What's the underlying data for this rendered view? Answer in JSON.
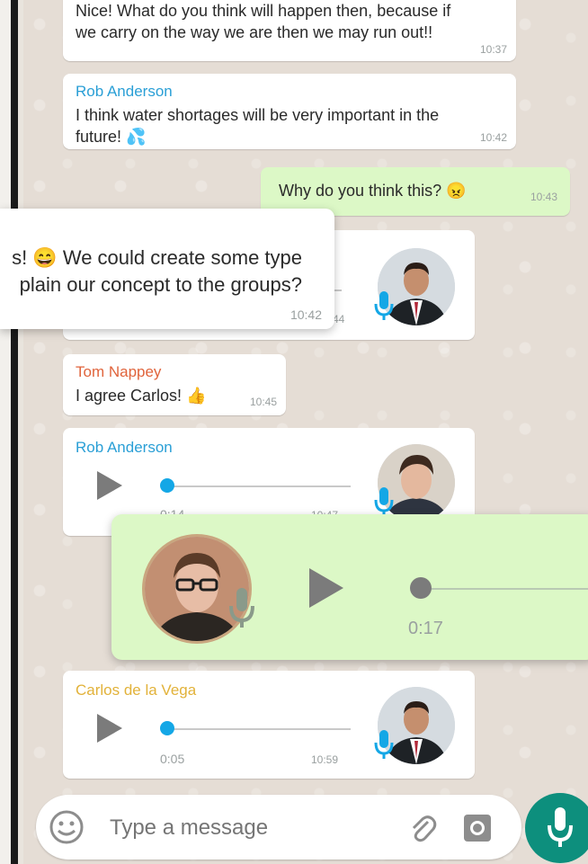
{
  "messages": {
    "m1": {
      "text_line1": "Nice! What do you think will happen then, because if",
      "text_line2": "we carry on the way we are then we may run out!!",
      "time": "10:37"
    },
    "m2": {
      "sender": "Rob Anderson",
      "text_line1": "I think water shortages will be very important in the",
      "text_line2": "future! 💦",
      "time": "10:42"
    },
    "m3": {
      "text": "Why do you think this? 😠",
      "time": "10:43"
    },
    "m4_popup": {
      "text_line1": "s! 😄 We could create some type",
      "text_line2": "plain our concept to the groups?",
      "time": "10:42"
    },
    "m4_under_time": "44",
    "m5": {
      "sender": "Tom Nappey",
      "text": "I agree Carlos! 👍",
      "time": "10:45"
    },
    "m6": {
      "sender": "Rob Anderson",
      "duration": "0:14",
      "time": "10:47",
      "progress": 0.0
    },
    "m7_zoom": {
      "duration": "0:17",
      "progress": 0.0
    },
    "m8": {
      "sender": "Carlos de la Vega",
      "duration": "0:05",
      "time": "10:59",
      "progress": 0.0
    }
  },
  "input": {
    "placeholder": "Type a message"
  },
  "colors": {
    "sender_blue": "#2a9fd6",
    "sender_red": "#e0643c",
    "sender_gold": "#e2b23a",
    "accent_green": "#0d8f7d",
    "outgoing_bubble": "#dcf8c6"
  },
  "icons": [
    "emoji-icon",
    "attachment-icon",
    "camera-icon",
    "microphone-icon",
    "play-icon"
  ]
}
